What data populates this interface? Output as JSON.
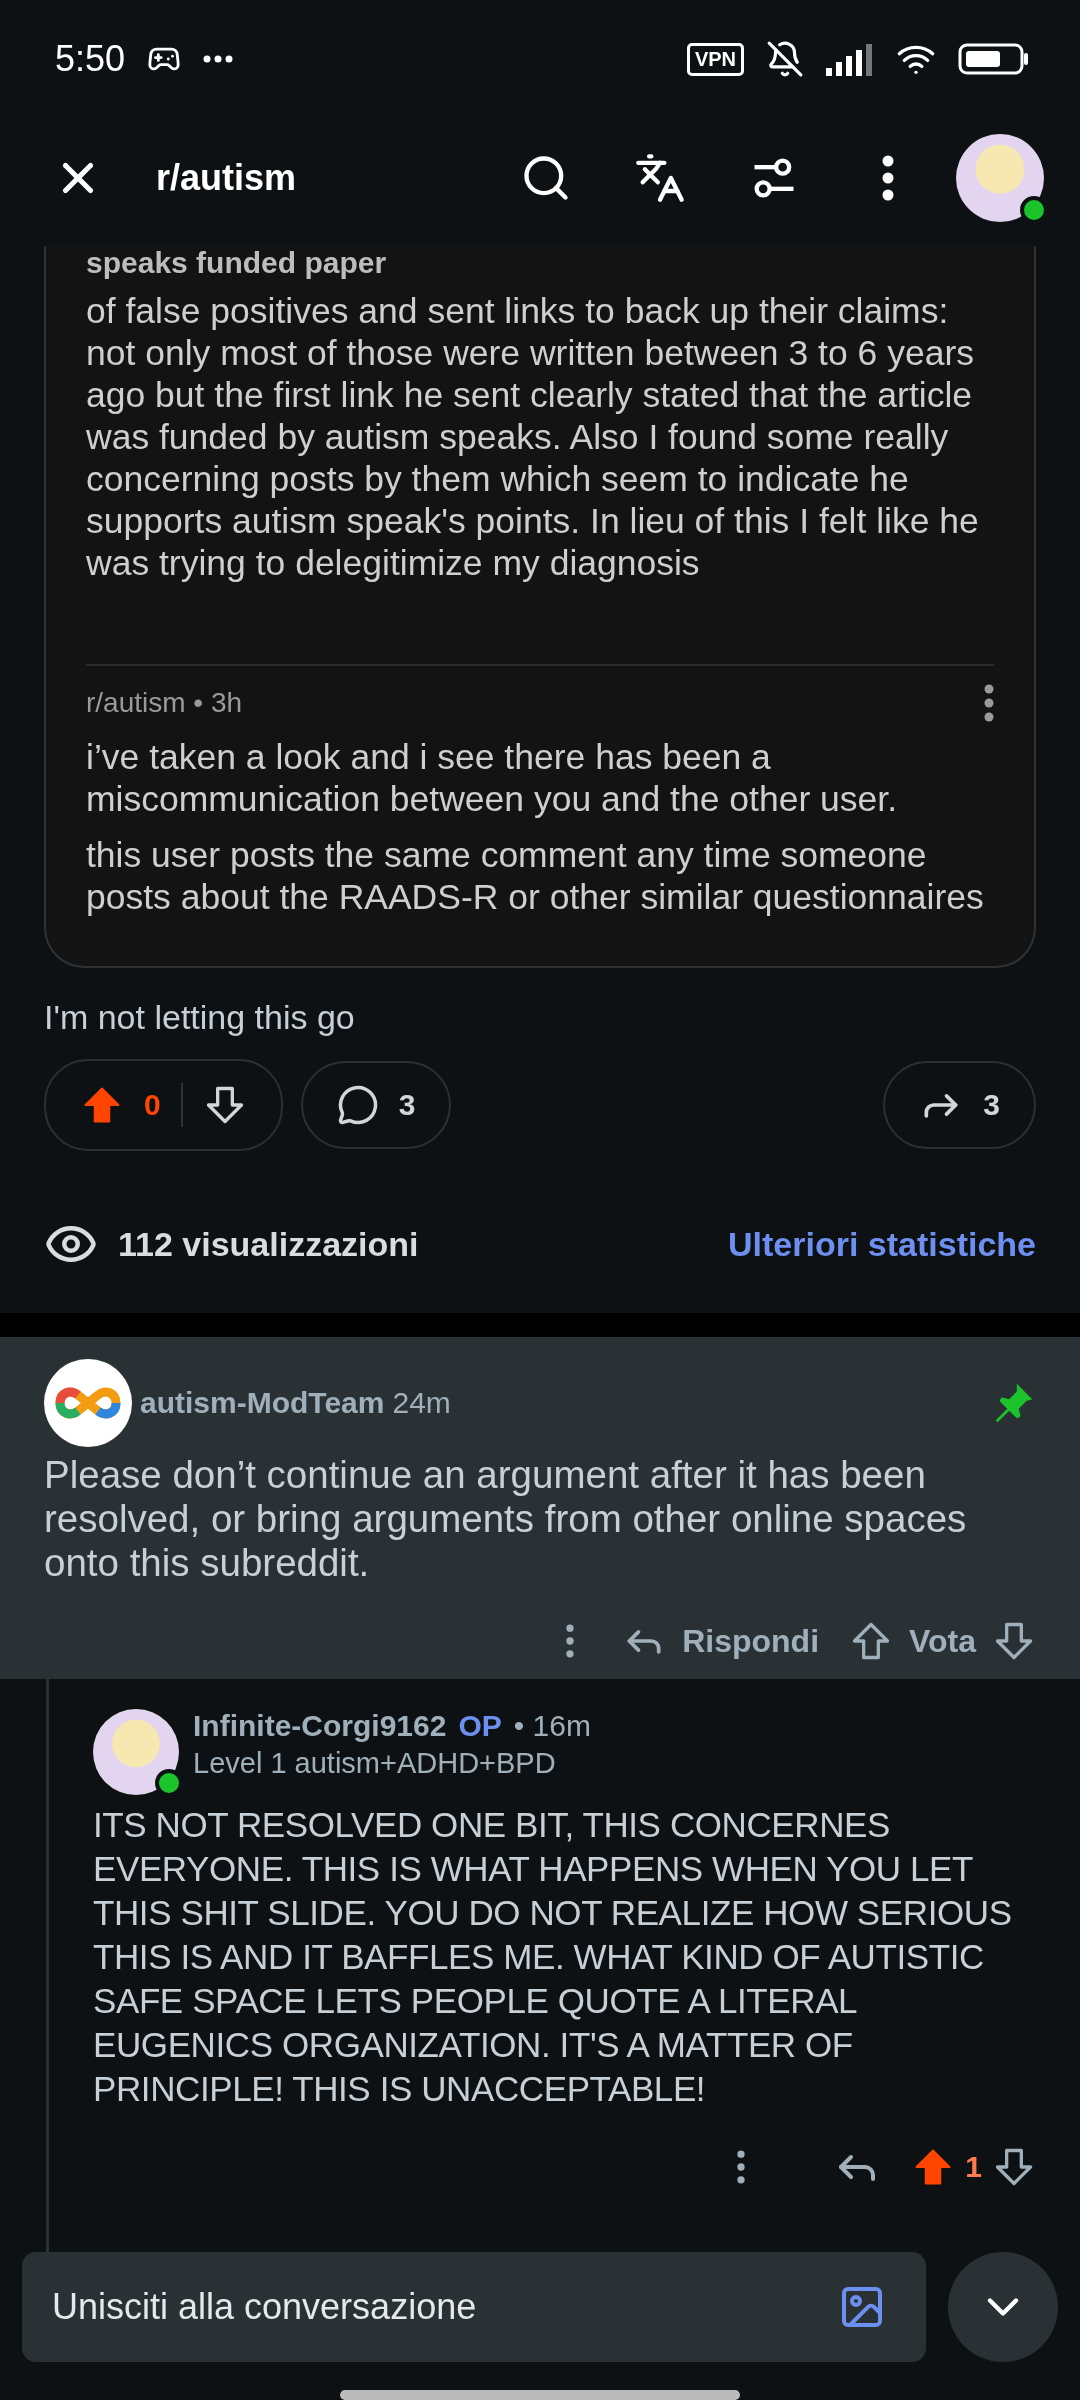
{
  "status_bar": {
    "time": "5:50",
    "vpn_badge": "VPN"
  },
  "top_bar": {
    "title": "r/autism",
    "avatar_online": true
  },
  "post": {
    "embedded_screenshot": {
      "heading": "speaks funded paper",
      "message": "of false positives and sent links to back up their claims: not only most of those were written between 3 to 6 years ago but the first link he sent clearly stated that the article was funded by autism speaks. Also I found some really concerning posts by them which seem to indicate he supports autism speak's points. In lieu of this I felt like he was trying to delegitimize my diagnosis",
      "reply_meta": "r/autism • 3h",
      "reply_paragraphs": [
        "i’ve taken a look and i see there has been a miscommunication between you and the other user.",
        "this user posts the same comment any time someone posts about the RAADS-R or other similar questionnaires"
      ]
    },
    "body": "I'm not letting this go",
    "score": "0",
    "upvoted": true,
    "comments": "3",
    "shares": "3",
    "views": "112 visualizzazioni",
    "stats_link": "Ulteriori statistiche"
  },
  "comments": [
    {
      "kind": "mod",
      "author": "autism-ModTeam",
      "time": "24m",
      "pinned": true,
      "body": "Please don’t continue an argument after it has been resolved, or bring arguments from other online spaces onto this subreddit.",
      "reply_label": "Rispondi",
      "vote_label": "Vota"
    },
    {
      "kind": "user",
      "author": "Infinite-Corgi9162",
      "op_badge": "OP",
      "time": "• 16m",
      "online": true,
      "flair": "Level 1 autism+ADHD+BPD",
      "body": "ITS NOT RESOLVED ONE BIT, THIS CONCERNES EVERYONE. THIS IS WHAT HAPPENS WHEN YOU LET THIS SHIT SLIDE. YOU DO NOT REALIZE HOW SERIOUS THIS IS AND IT BAFFLES ME. WHAT KIND OF AUTISTIC SAFE SPACE LETS PEOPLE QUOTE A LITERAL EUGENICS ORGANIZATION. IT'S A MATTER OF PRINCIPLE! THIS IS UNACCEPTABLE!",
      "score": "1",
      "upvoted": true
    }
  ],
  "composer": {
    "placeholder": "Unisciti alla conversazione"
  }
}
